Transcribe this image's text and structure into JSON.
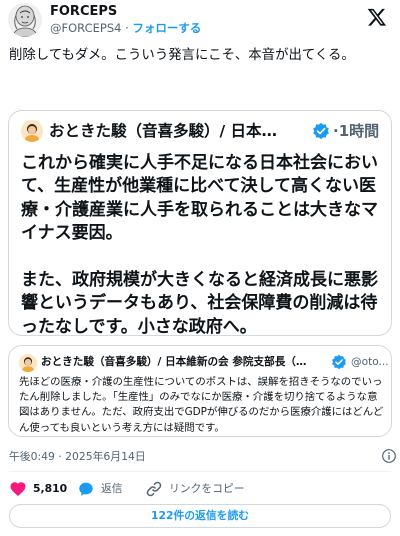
{
  "author": {
    "display_name": "FORCEPS",
    "handle": "@FORCEPS4",
    "separator": "·",
    "follow_label": "フォローする"
  },
  "tweet": {
    "text": "削除してもダメ。こういう発言にこそ、本音が出てくる。"
  },
  "image_card": {
    "author_name": "おときた駿（音喜多駿）/ 日本…",
    "time": "·1時間",
    "body": "これから確実に人手不足になる日本社会において、生産性が他業種に比べて決して高くない医療・介護産業に人手を取られることは大きなマイナス要因。\n\nまた、政府規模が大きくなると経済成長に悪影響というデータもあり、社会保障費の削減は待ったなしです。小さな政府へ。"
  },
  "quote": {
    "author_name": "おときた駿（音喜多駿）/ 日本維新の会 参院支部長（…",
    "handle": "@oto...",
    "body": "先ほどの医療・介護の生産性についてのポストは、誤解を招きそうなのでいったん削除しました。「生産性」のみでなにか医療・介護を切り捨てるような意図はありません。ただ、政府支出でGDPが伸びるのだから医療介護にはどんどん使っても良いという考え方には疑問です。"
  },
  "meta": {
    "timestamp": "午後0:49 · 2025年6月14日"
  },
  "actions": {
    "like_count": "5,810",
    "reply_label": "返信",
    "copy_link_label": "リンクをコピー"
  },
  "read_replies_label": "122件の返信を読む",
  "colors": {
    "accent": "#1d9bf0",
    "like": "#f91880",
    "verified": "#1d9bf0",
    "text": "#0f1419",
    "secondary": "#536471",
    "border": "#cfd9de"
  }
}
